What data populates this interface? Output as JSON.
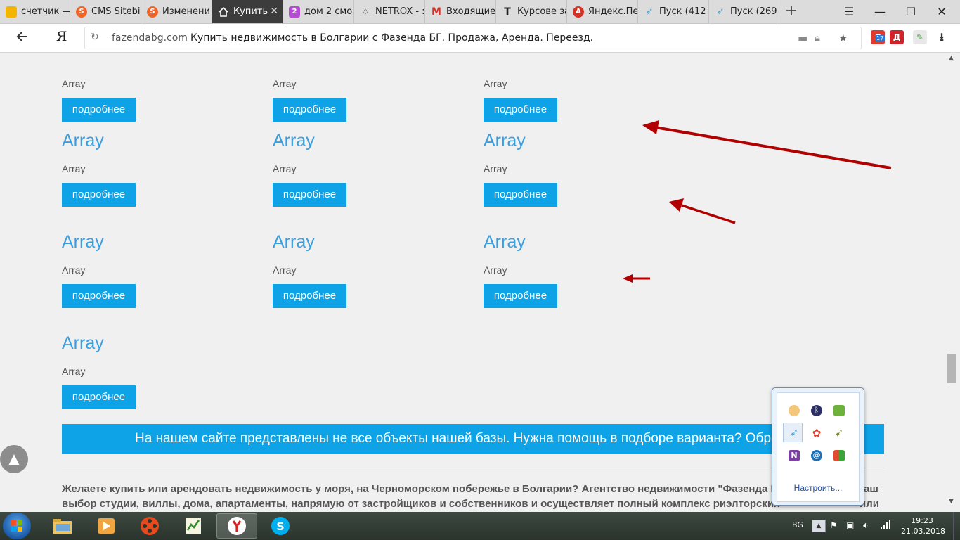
{
  "browser": {
    "tabs": [
      {
        "label": "счетчик —",
        "favicon_color": "#f2b600",
        "icon": "bars-icon",
        "active": false
      },
      {
        "label": "CMS Sitebi",
        "favicon_color": "#f0642a",
        "icon": "s-icon",
        "active": false
      },
      {
        "label": "Изменени",
        "favicon_color": "#f0642a",
        "icon": "s-icon",
        "active": false
      },
      {
        "label": "Купить",
        "favicon_color": "#ffffff",
        "icon": "house-icon",
        "active": true
      },
      {
        "label": "дом 2 смо",
        "favicon_color": "#b84bd6",
        "icon": "two-icon",
        "active": false
      },
      {
        "label": "NETROX - :",
        "favicon_color": "#666666",
        "icon": "diamond-icon",
        "active": false
      },
      {
        "label": "Входящие",
        "favicon_color": "#d93025",
        "icon": "gmail-icon",
        "active": false
      },
      {
        "label": "Курсове за",
        "favicon_color": "#222222",
        "icon": "t-icon",
        "active": false
      },
      {
        "label": "Яндекс.Пер",
        "favicon_color": "#d93025",
        "icon": "translate-icon",
        "active": false
      },
      {
        "label": "Пуск (412 l",
        "favicon_color": "#3aa0d8",
        "icon": "bird-icon",
        "active": false
      },
      {
        "label": "Пуск (269 l",
        "favicon_color": "#3aa0d8",
        "icon": "bird-icon",
        "active": false
      }
    ],
    "address": {
      "domain": "fazendabg.com",
      "page_title": "Купить недвижимость в Болгарии с Фазенда БГ. Продажа, Аренда. Переезд."
    },
    "yandex_logo": "Я",
    "ext_badge": "17",
    "ext_d_label": "Д"
  },
  "listing": {
    "rows": [
      [
        {
          "title": "",
          "subtitle": "Array",
          "button": "подробнее"
        },
        {
          "title": "",
          "subtitle": "Array",
          "button": "подробнее"
        },
        {
          "title": "",
          "subtitle": "Array",
          "button": "подробнее"
        }
      ],
      [
        {
          "title": "Array",
          "subtitle": "Array",
          "button": "подробнее"
        },
        {
          "title": "Array",
          "subtitle": "Array",
          "button": "подробнее"
        },
        {
          "title": "Array",
          "subtitle": "Array",
          "button": "подробнее"
        }
      ],
      [
        {
          "title": "Array",
          "subtitle": "Array",
          "button": "подробнее"
        },
        {
          "title": "Array",
          "subtitle": "Array",
          "button": "подробнее"
        },
        {
          "title": "Array",
          "subtitle": "Array",
          "button": "подробнее"
        }
      ],
      [
        {
          "title": "Array",
          "subtitle": "Array",
          "button": "подробнее"
        }
      ]
    ]
  },
  "banner": {
    "text": "На нашем сайте представлены не все объекты нашей базы. Нужна помощь в подборе варианта? Обраща"
  },
  "description": {
    "line1": "Желаете купить или арендовать недвижимость у моря, на Черноморском побережье в Болгарии? Агентство недвижимости \"Фазенда Б",
    "line1_end": "ваш",
    "line2": "выбор студии, виллы, дома, апартаменты, напрямую от застройщиков и собственников и осуществляет полный комплекс риэлторских",
    "line2_end": "или"
  },
  "tray_popup": {
    "icons": [
      "cheese-icon",
      "bluetooth-icon",
      "evernote-icon",
      "bird-icon",
      "flower-icon",
      "sparrow-icon",
      "onenote-icon",
      "at-icon",
      "windows-flag-icon"
    ],
    "customize_link": "Настроить..."
  },
  "taskbar": {
    "apps": [
      "explorer-icon",
      "media-player-icon",
      "film-reel-icon",
      "chart-notepad-icon",
      "yandex-browser-icon",
      "skype-icon"
    ],
    "language": "BG",
    "time": "19:23",
    "date": "21.03.2018"
  },
  "colors": {
    "accent_blue": "#0da3e6",
    "heading_blue": "#3a9fe0",
    "arrow_red": "#b00000"
  }
}
